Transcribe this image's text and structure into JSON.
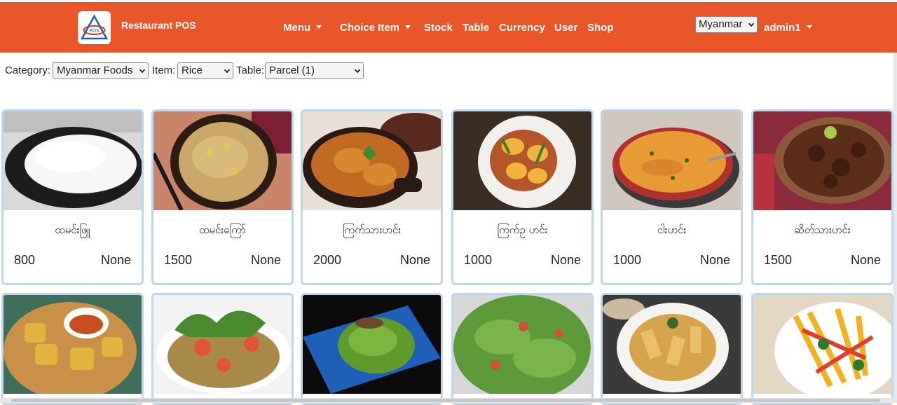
{
  "header": {
    "brand": "Restaurant POS",
    "nav": [
      {
        "label": "Menu",
        "dropdown": true
      },
      {
        "label": "Choice Item",
        "dropdown": true
      },
      {
        "label": "Stock",
        "dropdown": false
      },
      {
        "label": "Table",
        "dropdown": false
      },
      {
        "label": "Currency",
        "dropdown": false
      },
      {
        "label": "User",
        "dropdown": false
      },
      {
        "label": "Shop",
        "dropdown": false
      }
    ],
    "language": "Myanmar",
    "user": "admin1",
    "accent_color": "#e8562a"
  },
  "filters": {
    "category_label": "Category:",
    "category_value": "Myanmar Foods",
    "item_label": "Item:",
    "item_value": "Rice",
    "table_label": "Table:",
    "table_value": "Parcel (1)"
  },
  "products": [
    {
      "name": "ထမင်းဖြူ",
      "price": "800",
      "stock": "None",
      "image": "white-rice-bowl"
    },
    {
      "name": "ထမင်းကြော်",
      "price": "1500",
      "stock": "None",
      "image": "fried-rice-bowl"
    },
    {
      "name": "ကြက်သားဟင်း",
      "price": "2000",
      "stock": "None",
      "image": "chicken-curry-pot"
    },
    {
      "name": "ကြက်ဥ ဟင်း",
      "price": "1000",
      "stock": "None",
      "image": "egg-curry-plate"
    },
    {
      "name": "ငါးဟင်း",
      "price": "1000",
      "stock": "None",
      "image": "fish-curry-pan"
    },
    {
      "name": "ဆိတ်သားဟင်း",
      "price": "1500",
      "stock": "None",
      "image": "goat-curry-bowl"
    }
  ],
  "products_row2": [
    {
      "image": "fried-tofu-basket"
    },
    {
      "image": "tea-leaf-salad"
    },
    {
      "image": "green-salad-tray"
    },
    {
      "image": "lettuce-salad"
    },
    {
      "image": "tofu-noodle-salad"
    },
    {
      "image": "mango-salad"
    }
  ]
}
